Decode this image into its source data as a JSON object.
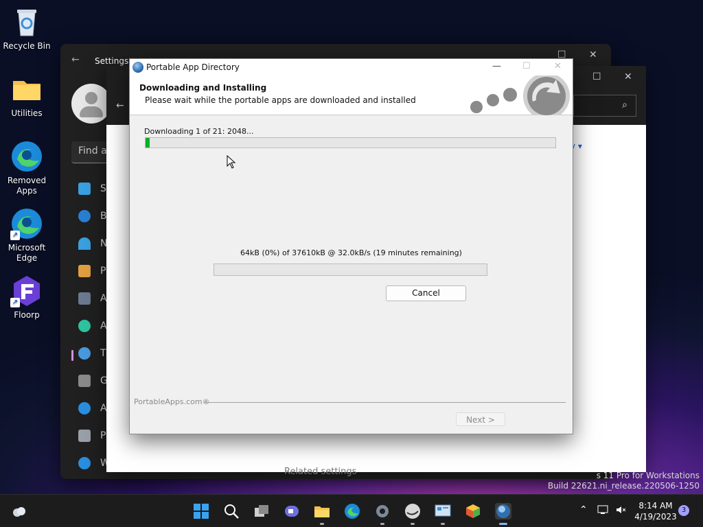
{
  "desktop": {
    "icons": [
      {
        "label": "Recycle Bin"
      },
      {
        "label": "Utilities"
      },
      {
        "label": "Removed Apps"
      },
      {
        "label": "Microsoft Edge"
      },
      {
        "label": "Floorp"
      }
    ]
  },
  "settings_window": {
    "title": "Settings",
    "find_placeholder": "Find a",
    "nav_fragments": [
      "S",
      "B",
      "N",
      "P",
      "A",
      "A",
      "T",
      "G",
      "A",
      "P",
      "W"
    ]
  },
  "back_window": {
    "link_fragment": "y ▾",
    "related_settings": "Related settings"
  },
  "dialog": {
    "title": "Portable App Directory",
    "header_title": "Downloading and Installing",
    "header_subtitle": "Please wait while the portable apps are downloaded and installed",
    "overall_label": "Downloading 1 of 21: 2048...",
    "overall_progress": 0.01,
    "file_status": "64kB (0%) of 37610kB @ 32.0kB/s (19 minutes remaining)",
    "file_progress": 0.0,
    "cancel_label": "Cancel",
    "next_label": "Next >",
    "brand": "PortableApps.com®"
  },
  "watermark": {
    "line1": "s 11 Pro for Workstations",
    "line2": "Build 22621.ni_release.220506-1250"
  },
  "taskbar": {
    "time": "8:14 AM",
    "date": "4/19/2023",
    "notification_count": "3",
    "apps": [
      "start",
      "search",
      "task-view",
      "chat",
      "file-explorer",
      "edge",
      "settings",
      "app",
      "portable-apps",
      "package",
      "portable-app-directory"
    ]
  },
  "colors": {
    "progress_green": "#06b025",
    "accent": "#1a5fc8"
  }
}
